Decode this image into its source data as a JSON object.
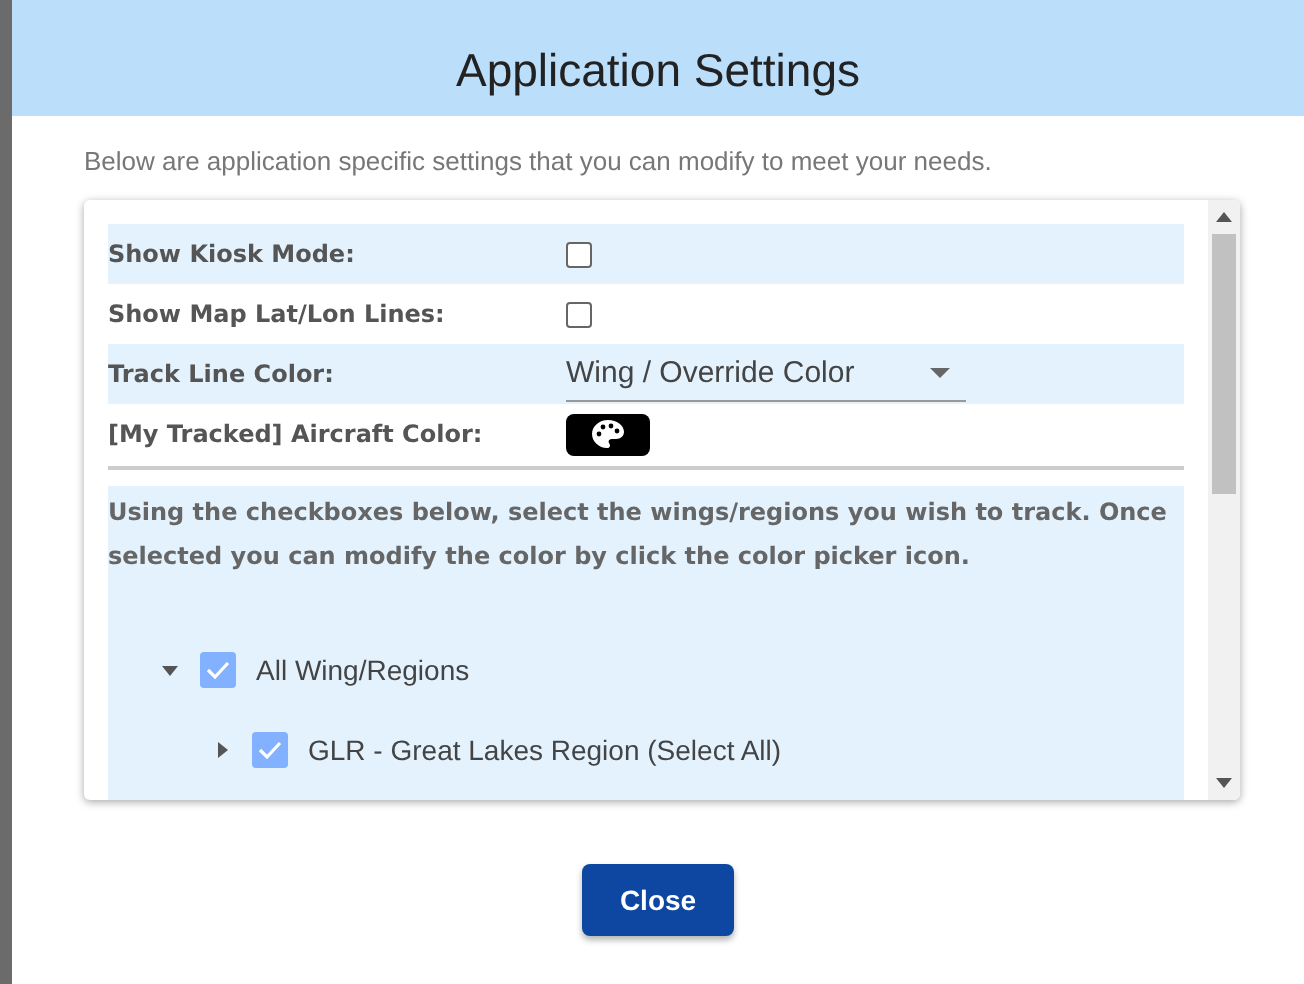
{
  "dialog": {
    "title": "Application Settings",
    "intro": "Below are application specific settings that you can modify to meet your needs."
  },
  "settings": [
    {
      "kind": "checkbox",
      "label": "Show Kiosk Mode:",
      "checked": false
    },
    {
      "kind": "checkbox",
      "label": "Show Map Lat/Lon Lines:",
      "checked": false
    },
    {
      "kind": "select",
      "label": "Track Line Color:",
      "value": "Wing / Override Color"
    },
    {
      "kind": "color",
      "label": "[My Tracked] Aircraft Color:"
    }
  ],
  "instructions": "Using the checkboxes below, select the wings/regions you wish to track. Once selected you can modify the color by click the color picker icon.",
  "tree": [
    {
      "label": "All Wing/Regions",
      "checked": true,
      "expanded": true,
      "children": [
        {
          "label": "GLR - Great Lakes Region (Select All)",
          "checked": true,
          "expanded": false
        }
      ]
    }
  ],
  "buttons": [
    "Close"
  ]
}
